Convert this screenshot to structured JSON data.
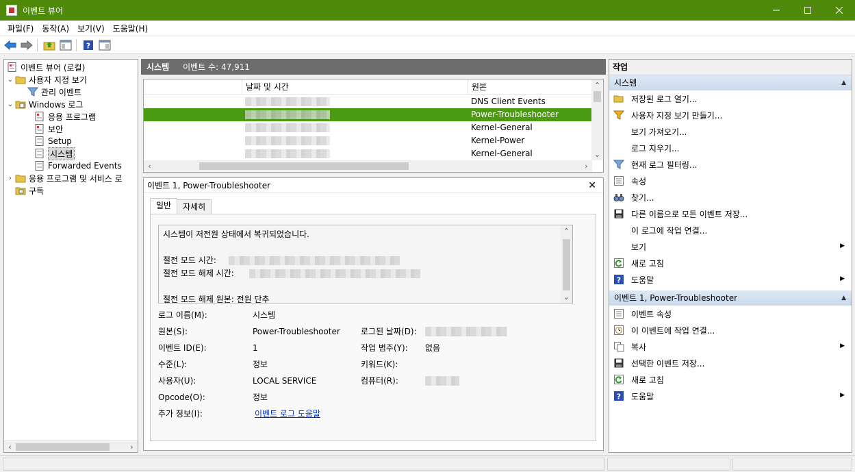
{
  "window": {
    "title": "이벤트 뷰어"
  },
  "menu": [
    "파일(F)",
    "동작(A)",
    "보기(V)",
    "도움말(H)"
  ],
  "tree": {
    "root": "이벤트 뷰어 (로컬)",
    "custom_views": "사용자 지정 보기",
    "admin_events": "관리 이벤트",
    "windows_logs": "Windows 로그",
    "application": "응용 프로그램",
    "security": "보안",
    "setup": "Setup",
    "system": "시스템",
    "forwarded": "Forwarded Events",
    "apps_services": "응용 프로그램 및 서비스 로",
    "subscriptions": "구독"
  },
  "center": {
    "log_name": "시스템",
    "event_count": "이벤트 수: 47,911",
    "columns": {
      "level": "",
      "date": "날짜 및 시간",
      "source": "원본"
    },
    "rows": [
      {
        "source": "DNS Client Events"
      },
      {
        "source": "Power-Troubleshooter"
      },
      {
        "source": "Kernel-General"
      },
      {
        "source": "Kernel-Power"
      },
      {
        "source": "Kernel-General"
      }
    ]
  },
  "detail": {
    "header": "이벤트 1, Power-Troubleshooter",
    "tabs": {
      "general": "일반",
      "details": "자세히"
    },
    "message": {
      "line1": "시스템이 저전원 상태에서 복귀되었습니다.",
      "sleep_time_label": "절전 모드 시간:",
      "wake_time_label": "절전 모드 해제 시간:",
      "wake_source": "절전 모드 해제 원본: 전원 단추"
    },
    "props": {
      "log_name_label": "로그 이름(M):",
      "log_name_value": "시스템",
      "source_label": "원본(S):",
      "source_value": "Power-Troubleshooter",
      "logged_label": "로그된 날짜(D):",
      "event_id_label": "이벤트 ID(E):",
      "event_id_value": "1",
      "task_label": "작업 범주(Y):",
      "task_value": "없음",
      "level_label": "수준(L):",
      "level_value": "정보",
      "keywords_label": "키워드(K):",
      "user_label": "사용자(U):",
      "user_value": "LOCAL SERVICE",
      "computer_label": "컴퓨터(R):",
      "opcode_label": "Opcode(O):",
      "opcode_value": "정보",
      "more_info_label": "추가 정보(I):",
      "more_info_link": "이벤트 로그 도움말"
    }
  },
  "actions": {
    "title": "작업",
    "section1": "시스템",
    "items1": [
      "저장된 로그 열기...",
      "사용자 지정 보기 만들기...",
      "보기 가져오기...",
      "로그 지우기...",
      "현재 로그 필터링...",
      "속성",
      "찾기...",
      "다른 이름으로 모든 이벤트 저장...",
      "이 로그에 작업 연결...",
      "보기",
      "새로 고침",
      "도움말"
    ],
    "section2": "이벤트 1, Power-Troubleshooter",
    "items2": [
      "이벤트 속성",
      "이 이벤트에 작업 연결...",
      "복사",
      "선택한 이벤트 저장...",
      "새로 고침",
      "도움말"
    ]
  }
}
